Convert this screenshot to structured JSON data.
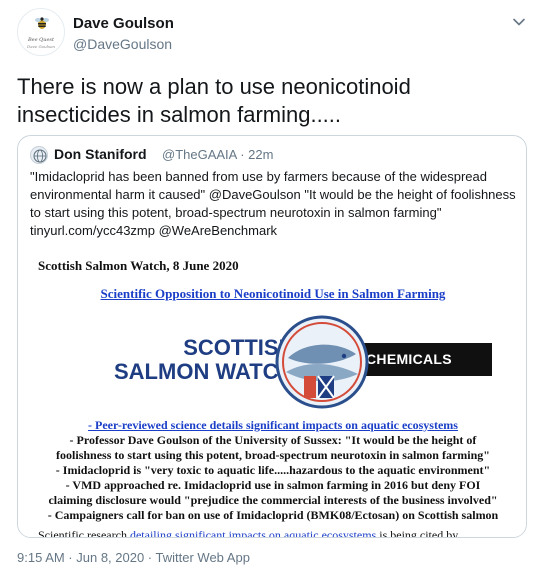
{
  "author": {
    "name": "Dave Goulson",
    "handle": "@DaveGoulson",
    "avatar_caption_1": "Bee Quest",
    "avatar_caption_2": "Dave Goulson"
  },
  "tweet": {
    "text": "There is now a plan to use neonicotinoid insecticides in salmon farming.....",
    "menu_icon": "chevron-down-icon"
  },
  "quoted": {
    "name": "Don Staniford",
    "handle_time": "@TheGAAIA · 22m",
    "text": "\"Imidacloprid has been banned from use by farmers because of the widespread environmental harm it caused\" @DaveGoulson \"It would be the height of foolishness to start using this potent, broad-spectrum neurotoxin in salmon farming\" tinyurl.com/ycc43zmp @WeAreBenchmark",
    "media": {
      "header": "Scottish Salmon Watch, 8 June 2020",
      "title_link": "Scientific Opposition to Neonicotinoid Use in Salmon Farming",
      "logo_line_1": "SCOTTISH",
      "logo_line_2": "SALMON WATCH",
      "badge": "CHEMICALS",
      "bullet_link": "- Peer-reviewed science details significant impacts on aquatic ecosystems",
      "bullet_1": "- Professor Dave Goulson of the University of Sussex: \"It would be the height of",
      "bullet_1b": "foolishness to start using this potent, broad-spectrum neurotoxin in salmon farming\"",
      "bullet_2": "- Imidacloprid is \"very toxic to aquatic life.....hazardous to the aquatic environment\"",
      "bullet_3": "- VMD approached re. Imidacloprid use in salmon farming in 2016 but deny FOI",
      "bullet_3b": "claiming disclosure would \"prejudice the commercial interests of the business involved\"",
      "bullet_4": "- Campaigners call for ban on use of Imidacloprid (BMK08/Ectosan) on Scottish salmon",
      "footer_pre": "Scientific research ",
      "footer_link": "detailing significant impacts on aquatic ecosystems",
      "footer_post": " is being cited by"
    }
  },
  "meta": {
    "time": "9:15 AM · Jun 8, 2020 · ",
    "source": "Twitter Web App"
  },
  "colors": {
    "text": "#14171a",
    "secondary": "#657786",
    "border": "#ccd6dd",
    "link_blue": "#1a3ec8",
    "logo_blue": "#1f3d82"
  }
}
